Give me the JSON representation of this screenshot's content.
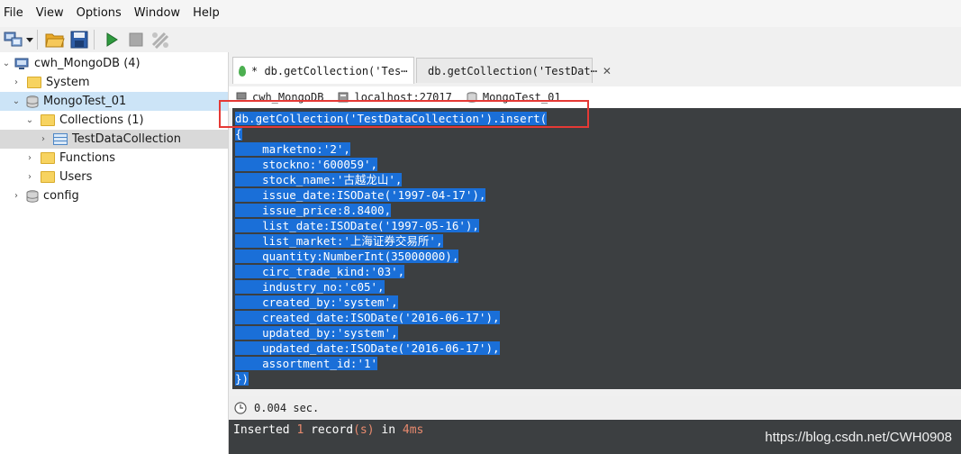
{
  "menu": [
    "File",
    "View",
    "Options",
    "Window",
    "Help"
  ],
  "toolbar": {
    "icons": [
      "connect-icon",
      "open-folder-icon",
      "save-icon",
      "run-icon",
      "stop-icon",
      "format-icon"
    ]
  },
  "tree": {
    "root": "cwh_MongoDB (4)",
    "system": "System",
    "database": "MongoTest_01",
    "collections": "Collections (1)",
    "collection_item": "TestDataCollection",
    "functions": "Functions",
    "users": "Users",
    "config": "config"
  },
  "tabs": [
    {
      "label": "*   db.getCollection('Tes⋯",
      "active": true
    },
    {
      "label": "db.getCollection('TestDat⋯",
      "active": false
    }
  ],
  "connection": {
    "server": "cwh_MongoDB",
    "host": "localhost:27017",
    "database": "MongoTest_01"
  },
  "editor": {
    "lines": [
      "db.getCollection('TestDataCollection').insert(",
      "{",
      "    marketno:'2',",
      "    stockno:'600059',",
      "    stock_name:'古越龙山',",
      "    issue_date:ISODate('1997-04-17'),",
      "    issue_price:8.8400,",
      "    list_date:ISODate('1997-05-16'),",
      "    list_market:'上海证券交易所',",
      "    quantity:NumberInt(35000000),",
      "    circ_trade_kind:'03',",
      "    industry_no:'c05',",
      "    created_by:'system',",
      "    created_date:ISODate('2016-06-17'),",
      "    updated_by:'system',",
      "    updated_date:ISODate('2016-06-17'),",
      "    assortment_id:'1'",
      "})"
    ]
  },
  "status": {
    "time": "0.004 sec."
  },
  "output": {
    "prefix": "Inserted ",
    "count": "1",
    "middle": " record",
    "paren": "(s)",
    "in": " in ",
    "duration": "4ms"
  },
  "watermark": "https://blog.csdn.net/CWH0908",
  "colors": {
    "selection": "#1a6fd8",
    "editor_bg": "#3c3f41",
    "annotation_red": "#e53935"
  }
}
